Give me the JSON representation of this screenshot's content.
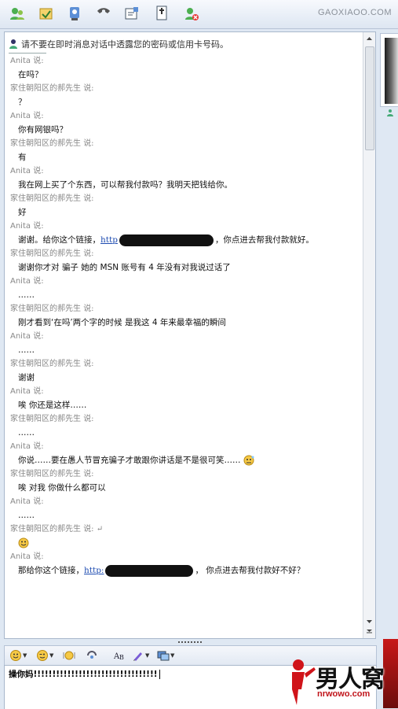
{
  "toolbar": {
    "brand": "GAOXIAOO.COM",
    "buttons": [
      "invite-contact-icon",
      "send-file-icon",
      "video-icon",
      "voice-call-icon",
      "share-folder-icon",
      "games-icon",
      "block-icon"
    ]
  },
  "warning": {
    "text": "请不要在即时消息对话中透露您的密码或信用卡号码。"
  },
  "messages": [
    {
      "sender": "Anita",
      "said": "说:",
      "body": "在吗？"
    },
    {
      "sender": "家住朝阳区的郝先生",
      "said": "说:",
      "body": "？"
    },
    {
      "sender": "Anita",
      "said": "说:",
      "body": "你有网银吗？"
    },
    {
      "sender": "家住朝阳区的郝先生",
      "said": "说:",
      "body": "有"
    },
    {
      "sender": "Anita",
      "said": "说:",
      "body": "我在网上买了个东西，可以帮我付款吗？我明天把钱给你。"
    },
    {
      "sender": "家住朝阳区的郝先生",
      "said": "说:",
      "body": "好"
    },
    {
      "sender": "Anita",
      "said": "说:",
      "body_pre": "谢谢。给你这个链接，",
      "link": "http",
      "body_post": "，你点进去帮我付款就好。"
    },
    {
      "sender": "家住朝阳区的郝先生",
      "said": "说:",
      "body": "谢谢你才对  骗子  她的 MSN 账号有 4 年没有对我说过话了"
    },
    {
      "sender": "Anita",
      "said": "说:",
      "body": "……"
    },
    {
      "sender": "家住朝阳区的郝先生",
      "said": "说:",
      "body": "刚才看到‘在吗’两个字的时候  是我这 4 年来最幸福的瞬间"
    },
    {
      "sender": "Anita",
      "said": "说:",
      "body": "……"
    },
    {
      "sender": "家住朝阳区的郝先生",
      "said": "说:",
      "body": "谢谢"
    },
    {
      "sender": "Anita",
      "said": "说:",
      "body": "唉  你还是这样……"
    },
    {
      "sender": "家住朝阳区的郝先生",
      "said": "说:",
      "body": "……"
    },
    {
      "sender": "Anita",
      "said": "说:",
      "body": "你说……要在愚人节冒充骗子才敢跟你讲话是不是很可笑……"
    },
    {
      "sender": "家住朝阳区的郝先生",
      "said": "说:",
      "body": "唉  对我  你做什么都可以"
    },
    {
      "sender": "Anita",
      "said": "说:",
      "body": "……"
    },
    {
      "sender": "家住朝阳区的郝先生",
      "said": "说: ↵",
      "body": ""
    },
    {
      "sender": "Anita",
      "said": "说:",
      "body_pre": "那给你这个链接，",
      "link": "http:",
      "body_post": "，  你点进去帮我付款好不好？"
    }
  ],
  "input": {
    "text": "操你妈!!!!!!!!!!!!!!!!!!!!!!!!!!!!!!!!!"
  },
  "input_toolbar": [
    "emoticon-icon",
    "wink-icon",
    "nudge-icon",
    "voice-clip-icon",
    "font-icon",
    "background-icon",
    "gallery-icon"
  ],
  "watermark": {
    "logo_text": "男人窝",
    "url": "nrwowo.com"
  },
  "colors": {
    "link": "#1c4ab0",
    "sender": "#888888",
    "accent": "#c0141a"
  }
}
